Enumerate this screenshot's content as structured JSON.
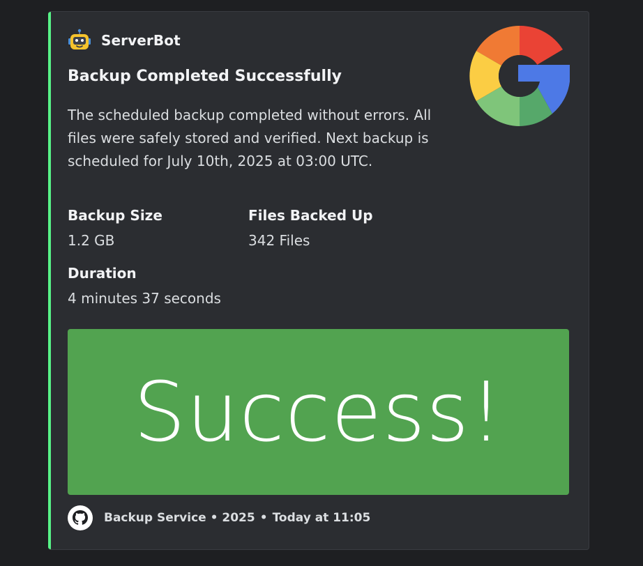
{
  "colors": {
    "accent": "#57f287",
    "embed_bg": "#2b2d31",
    "page_bg": "#1e1f22",
    "banner_bg": "#52a350"
  },
  "author": {
    "icon": "robot-icon",
    "name": "ServerBot"
  },
  "embed": {
    "title": "Backup Completed Successfully",
    "description": "The scheduled backup completed without errors. All files were safely stored and verified. Next backup is scheduled for July 10th, 2025 at 03:00 UTC.",
    "thumbnail_icon": "google-logo-icon"
  },
  "fields": [
    {
      "name": "Backup Size",
      "value": "1.2 GB"
    },
    {
      "name": "Files Backed Up",
      "value": "342 Files"
    },
    {
      "name": "Duration",
      "value": "4 minutes 37 seconds"
    }
  ],
  "image": {
    "text": "Success!"
  },
  "footer": {
    "icon": "github-icon",
    "text": "Backup Service • 2025",
    "separator": "•",
    "timestamp": "Today at 11:05"
  }
}
